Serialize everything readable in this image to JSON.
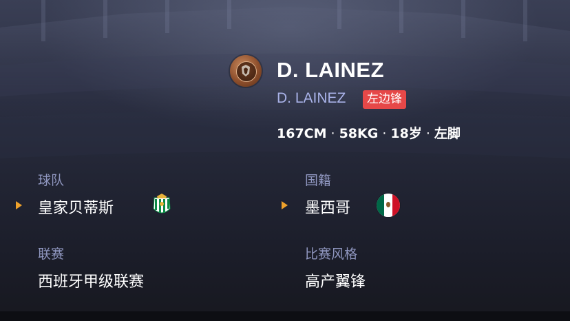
{
  "player": {
    "name": "D. LAINEZ",
    "sub_name": "D. LAINEZ",
    "position": "左边锋",
    "height": "167CM",
    "weight": "58KG",
    "age": "18岁",
    "foot": "左脚",
    "separator": "·"
  },
  "fields": {
    "team": {
      "label": "球队",
      "value": "皇家贝蒂斯"
    },
    "nationality": {
      "label": "国籍",
      "value": "墨西哥"
    },
    "league": {
      "label": "联赛",
      "value": "西班牙甲级联赛"
    },
    "style": {
      "label": "比赛风格",
      "value": "高产翼锋"
    }
  },
  "icons": {
    "club_badge": "club-badge-icon",
    "team_crest": "real-betis-crest-icon",
    "nation_flag": "mexico-flag-icon",
    "arrow": "orange-triangle-arrow-icon"
  },
  "colors": {
    "accent_arrow": "#f0a22b",
    "position_badge": "#e64848",
    "label": "#8f96bf",
    "sub_name": "#a9b2e8"
  }
}
